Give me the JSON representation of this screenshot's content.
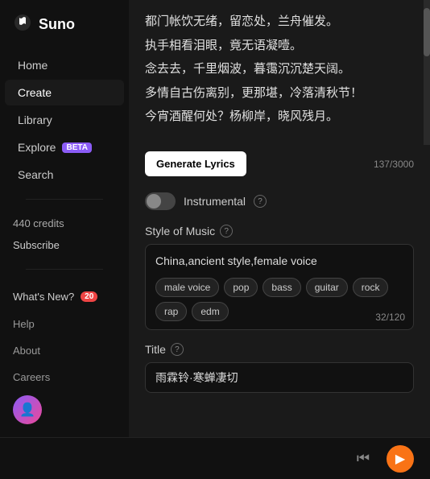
{
  "sidebar": {
    "logo": {
      "text": "Suno",
      "icon": "🎵"
    },
    "nav_items": [
      {
        "label": "Home",
        "active": false,
        "id": "home"
      },
      {
        "label": "Create",
        "active": true,
        "id": "create"
      },
      {
        "label": "Library",
        "active": false,
        "id": "library"
      },
      {
        "label": "Explore",
        "active": false,
        "id": "explore",
        "badge": "BETA"
      }
    ],
    "search_label": "Search",
    "credits": "440 credits",
    "subscribe": "Subscribe",
    "whats_new": "What's New?",
    "notif_count": "20",
    "links": [
      "Help",
      "About",
      "Careers"
    ]
  },
  "main": {
    "lyrics": [
      "都门帐饮无绪，留恋处，兰舟催发。",
      "执手相看泪眼，竟无语凝噎。",
      "念去去，千里烟波，暮霭沉沉楚天阔。",
      "多情自古伤离别，更那堪，冷落清秋节！",
      "今宵酒醒何处？杨柳岸，晓风残月。"
    ],
    "generate_btn": "Generate Lyrics",
    "lyrics_char_count": "137/3000",
    "instrumental_label": "Instrumental",
    "help_icon_label": "?",
    "style_section_label": "Style of Music",
    "style_text": "China,ancient style,female voice",
    "style_tags": [
      "male voice",
      "pop",
      "bass",
      "guitar",
      "rock",
      "rap",
      "edm"
    ],
    "style_char_count": "32/120",
    "title_section_label": "Title",
    "title_value": "雨霖铃·寒蝉凄切"
  },
  "player": {
    "skip_icon": "⏮",
    "play_icon": "▶"
  },
  "colors": {
    "accent": "#f97316",
    "active_nav_bg": "#1a1a1a",
    "beta_badge": "#8b5cf6"
  }
}
